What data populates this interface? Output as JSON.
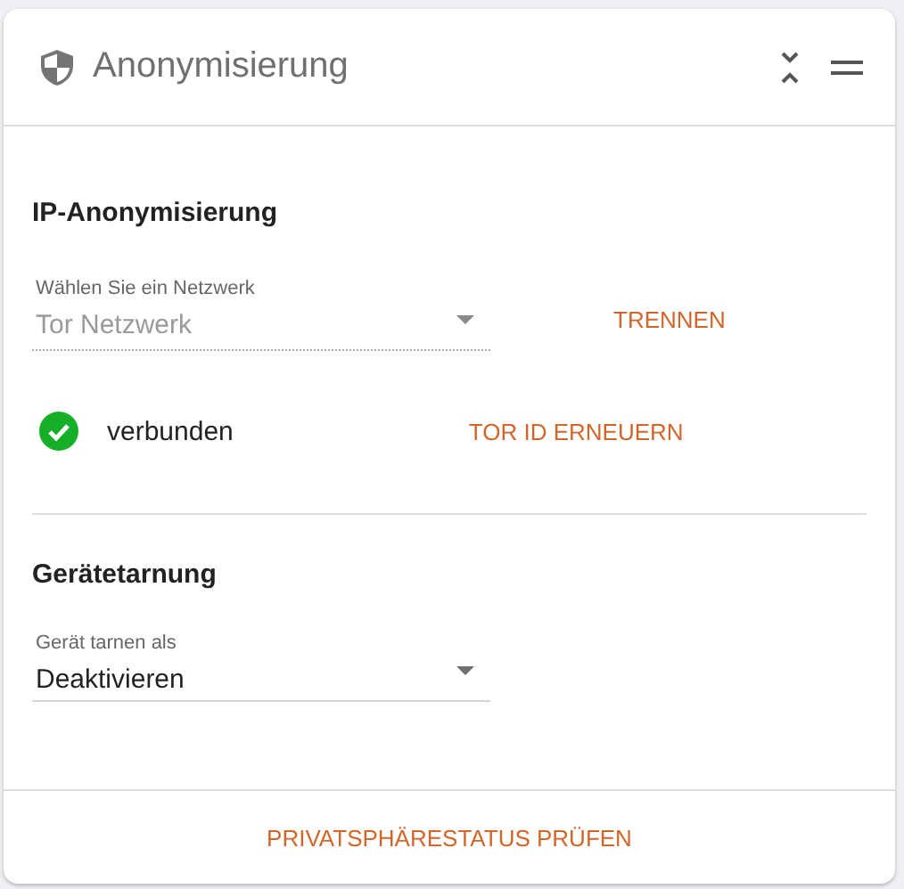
{
  "header": {
    "title": "Anonymisierung"
  },
  "ip_section": {
    "title": "IP-Anonymisierung",
    "network_select": {
      "label": "Wählen Sie ein Netzwerk",
      "value": "Tor Netzwerk",
      "disabled": true
    },
    "disconnect_button": "TRENNEN",
    "status": {
      "connected": true,
      "text": "verbunden"
    },
    "renew_button": "TOR ID ERNEUERN"
  },
  "device_section": {
    "title": "Gerätetarnung",
    "device_select": {
      "label": "Gerät tarnen als",
      "value": "Deaktivieren",
      "disabled": false
    }
  },
  "footer_button": "PRIVATSPHÄRESTATUS PRÜFEN"
}
